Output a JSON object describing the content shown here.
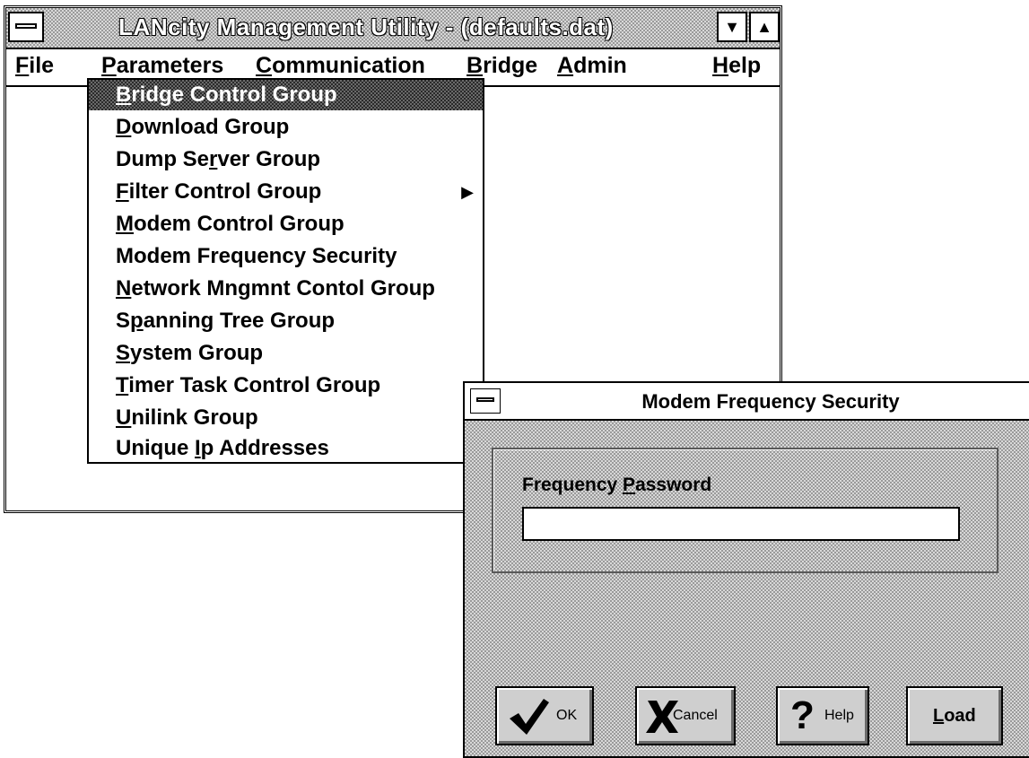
{
  "main_window": {
    "title": "LANcity Management Utility - (defaults.dat)",
    "min_symbol": "▼",
    "max_symbol": "▲"
  },
  "menubar": {
    "items": [
      {
        "label": "File",
        "accel": "F",
        "rest": "ile"
      },
      {
        "label": "Parameters",
        "accel": "P",
        "rest": "arameters"
      },
      {
        "label": "Communication",
        "accel": "C",
        "rest": "ommunication"
      },
      {
        "label": "Bridge",
        "accel": "B",
        "rest": "ridge"
      },
      {
        "label": "Admin",
        "accel": "A",
        "rest": "dmin"
      },
      {
        "label": "Help",
        "accel": "H",
        "rest": "elp"
      }
    ]
  },
  "parameters_menu": {
    "items": [
      {
        "label": "Bridge Control Group",
        "pre": "",
        "accel": "B",
        "post": "ridge Control Group",
        "selected": true
      },
      {
        "label": "Download Group",
        "pre": "",
        "accel": "D",
        "post": "ownload Group"
      },
      {
        "label": "Dump Server Group",
        "pre": "Dump Se",
        "accel": "r",
        "post": "ver Group"
      },
      {
        "label": "Filter Control Group",
        "pre": "",
        "accel": "F",
        "post": "ilter Control Group",
        "submenu_arrow": "▶"
      },
      {
        "label": "Modem Control Group",
        "pre": "",
        "accel": "M",
        "post": "odem Control Group"
      },
      {
        "label": "Modem Frequency Security",
        "pre": "Modem Frequency Security",
        "accel": "",
        "post": ""
      },
      {
        "label": "Network Mngmnt Contol Group",
        "pre": "",
        "accel": "N",
        "post": "etwork Mngmnt Contol Group"
      },
      {
        "label": "Spanning Tree Group",
        "pre": "S",
        "accel": "p",
        "post": "anning Tree Group"
      },
      {
        "label": "System Group",
        "pre": "",
        "accel": "S",
        "post": "ystem Group"
      },
      {
        "label": "Timer Task Control Group",
        "pre": "",
        "accel": "T",
        "post": "imer Task Control Group"
      },
      {
        "label": "Unilink Group",
        "pre": "",
        "accel": "U",
        "post": "nilink Group"
      },
      {
        "label": "Unique Ip Addresses",
        "pre": "Unique ",
        "accel": "I",
        "post": "p Addresses"
      }
    ]
  },
  "dialog": {
    "title": "Modem Frequency Security",
    "password_label_pre": "Frequency ",
    "password_label_accel": "P",
    "password_label_post": "assword",
    "password_value": "",
    "buttons": {
      "ok": "OK",
      "cancel": "Cancel",
      "help": "Help",
      "load_accel": "L",
      "load_rest": "oad"
    }
  }
}
